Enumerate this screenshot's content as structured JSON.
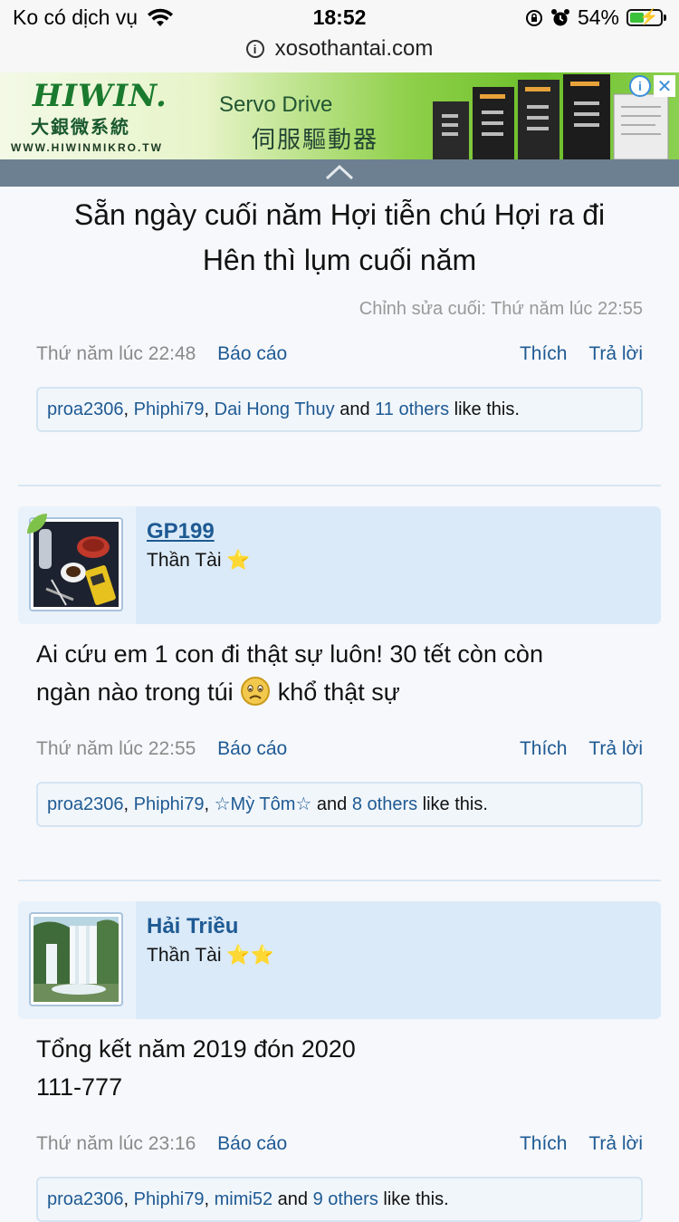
{
  "status": {
    "carrier": "Ko có dịch vụ",
    "time": "18:52",
    "battery": "54%",
    "battery_level": 0.54,
    "url": "xosothantai.com"
  },
  "ad": {
    "brand": "HIWIN.",
    "brand_cjk": "大銀微系統",
    "brand_url": "WWW.HIWINMIKRO.TW",
    "title": "Servo Drive",
    "subtitle": "伺服驅動器",
    "info_label": "i",
    "close_label": "✕"
  },
  "post1": {
    "body_line1": "Sẵn ngày cuối năm Hợi tiễn chú Hợi ra đi",
    "body_line2": "Hên thì lụm cuối năm",
    "edited": "Chỉnh sửa cuối: Thứ năm lúc 22:55",
    "date": "Thứ năm lúc 22:48",
    "report": "Báo cáo",
    "like": "Thích",
    "reply": "Trả lời",
    "likes": {
      "users": [
        "proa2306",
        "Phiphi79",
        "Dai Hong Thuy"
      ],
      "sep": ", ",
      "and": "and",
      "others": "11 others",
      "suffix": "like this."
    }
  },
  "post2": {
    "username": "GP199",
    "usertitle": "Thần Tài",
    "stars": "⭐",
    "body_line1": "Ai cứu em 1 con đi thật sự luôn! 30 tết còn còn",
    "body_line2a": "ngàn nào trong túi",
    "body_line2b": "khổ thật sự",
    "date": "Thứ năm lúc 22:55",
    "report": "Báo cáo",
    "like": "Thích",
    "reply": "Trả lời",
    "likes": {
      "users": [
        "proa2306",
        "Phiphi79",
        "☆Mỳ Tôm☆"
      ],
      "sep": ", ",
      "and": "and",
      "others": "8 others",
      "suffix": "like this."
    }
  },
  "post3": {
    "username": "Hải Triều",
    "usertitle": "Thần Tài",
    "stars": "⭐⭐",
    "body_line1": "Tổng kết năm 2019 đón 2020",
    "body_line2": "111-777",
    "date": "Thứ năm lúc 23:16",
    "report": "Báo cáo",
    "like": "Thích",
    "reply": "Trả lời",
    "likes": {
      "users": [
        "proa2306",
        "Phiphi79",
        "mimi52"
      ],
      "sep": ", ",
      "and": "and",
      "others": "9 others",
      "suffix": "like this."
    }
  },
  "colors": {
    "link": "#1e5a93",
    "userbar": "#dbeaf8",
    "likes_bg": "#f1f6fb",
    "separator": "#d6e6f3"
  }
}
